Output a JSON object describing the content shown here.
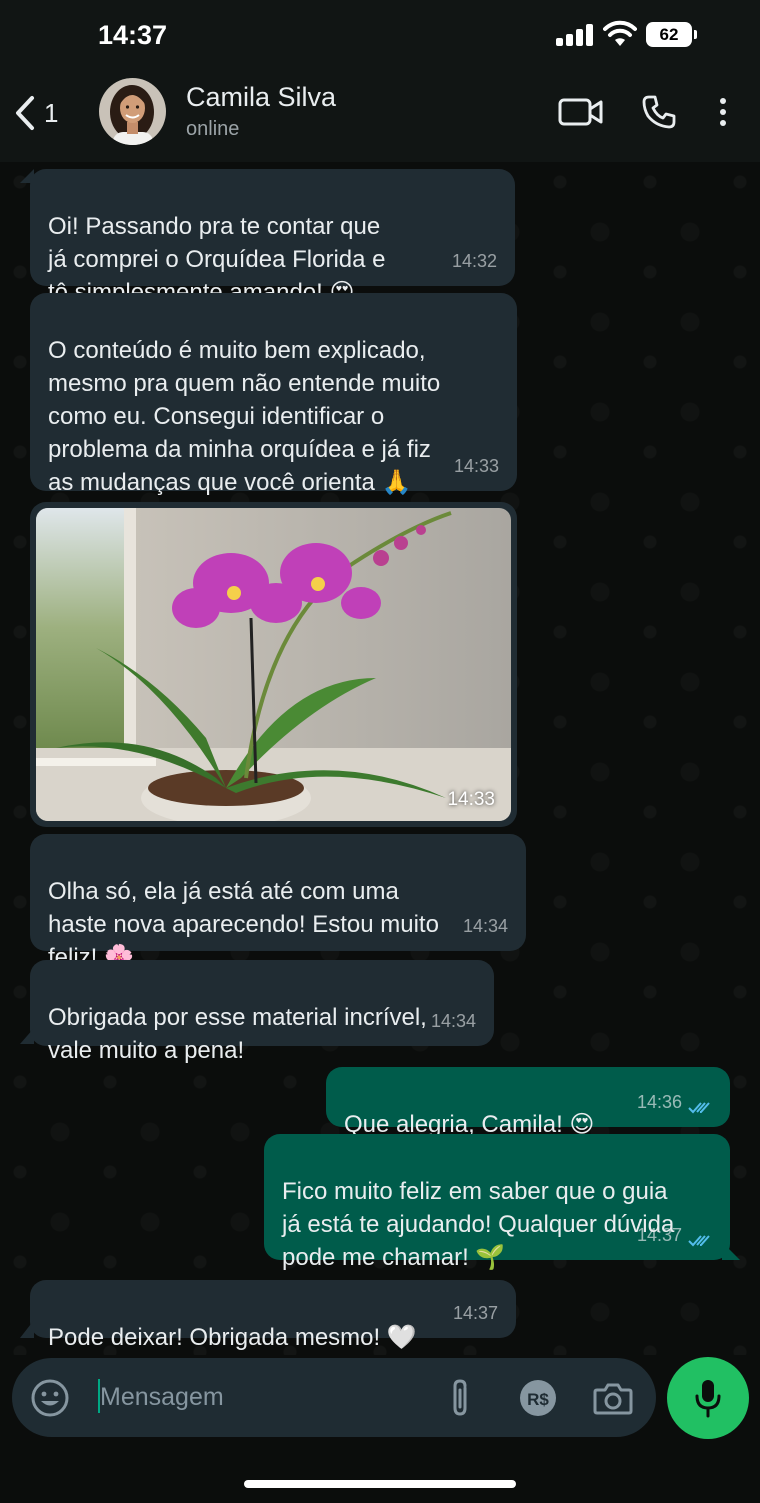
{
  "status_bar": {
    "time": "14:37",
    "battery": "62"
  },
  "header": {
    "back_count": "1",
    "contact_name": "Camila Silva",
    "contact_status": "online"
  },
  "messages": [
    {
      "direction": "in",
      "text": "Oi! Passando pra te contar que\njá comprei o Orquídea Florida e\ntô simplesmente amando! 😍",
      "time": "14:32"
    },
    {
      "direction": "in",
      "text": "O conteúdo é muito bem explicado,\nmesmo pra quem não entende muito\ncomo eu. Consegui identificar o\nproblema da minha orquídea e já fiz\nas mudanças que você orienta 🙏",
      "time": "14:33"
    },
    {
      "direction": "in",
      "type": "image",
      "time": "14:33"
    },
    {
      "direction": "in",
      "text": "Olha só, ela já está até com uma\nhaste nova aparecendo! Estou muito\nfeliz! 🌸",
      "time": "14:34"
    },
    {
      "direction": "in",
      "text": "Obrigada por esse material incrível,\nvale muito a pena!",
      "time": "14:34"
    },
    {
      "direction": "out",
      "text": "Que alegria, Camila! 😍",
      "time": "14:36",
      "status": "read"
    },
    {
      "direction": "out",
      "text": "Fico muito feliz em saber que o guia\njá está te ajudando! Qualquer dúvida\npode me chamar! 🌱",
      "time": "14:37",
      "status": "read"
    },
    {
      "direction": "in",
      "text": "Pode deixar! Obrigada mesmo! 🤍",
      "time": "14:37"
    }
  ],
  "input": {
    "placeholder": "Mensagem",
    "value": ""
  },
  "colors": {
    "incoming_bubble": "#202c33",
    "outgoing_bubble": "#005c4b",
    "mic_button": "#21c063",
    "read_ticks": "#53bdeb"
  }
}
